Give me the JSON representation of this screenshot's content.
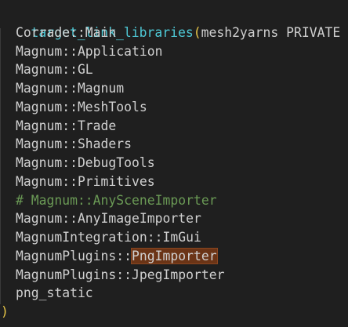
{
  "editor": {
    "colors": {
      "background": "#1f1f1f",
      "function": "#4ec9d6",
      "paren": "#e7c547",
      "text": "#d0d0d0",
      "comment": "#6a9955",
      "highlight": "#6b3416"
    },
    "header": {
      "function_name": "target_link_libraries",
      "open_paren": "(",
      "args": "mesh2yarns PRIVATE"
    },
    "lines": [
      "Corrade::Main",
      "Magnum::Application",
      "Magnum::GL",
      "Magnum::Magnum",
      "Magnum::MeshTools",
      "Magnum::Trade",
      "Magnum::Shaders",
      "Magnum::DebugTools",
      "Magnum::Primitives"
    ],
    "comment_line": "# Magnum::AnySceneImporter",
    "lines_after_comment": [
      "Magnum::AnyImageImporter",
      "MagnumIntegration::ImGui"
    ],
    "highlight_line": {
      "prefix": "MagnumPlugins::",
      "highlighted": "PngImporter"
    },
    "lines_tail": [
      "MagnumPlugins::JpegImporter",
      "png_static"
    ],
    "close_paren": ")"
  }
}
